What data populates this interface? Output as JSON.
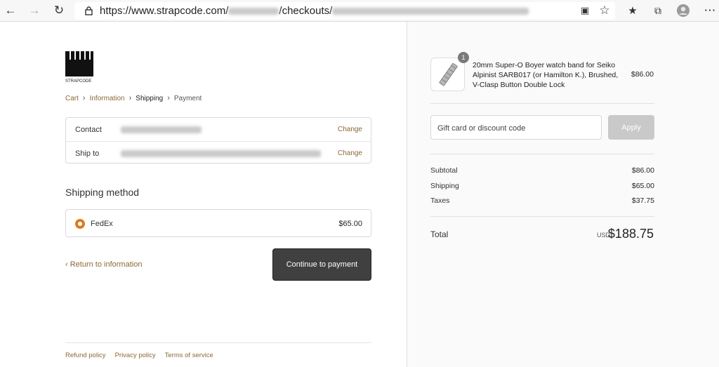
{
  "browser": {
    "url_prefix": "https://www.strapcode.com/",
    "url_mid": "/checkouts/"
  },
  "breadcrumbs": {
    "cart": "Cart",
    "information": "Information",
    "shipping": "Shipping",
    "payment": "Payment"
  },
  "review": {
    "contact_label": "Contact",
    "ship_to_label": "Ship to",
    "change": "Change"
  },
  "shipping": {
    "title": "Shipping method",
    "option_name": "FedEx",
    "option_price": "$65.00"
  },
  "actions": {
    "return": "Return to information",
    "continue": "Continue to payment"
  },
  "footer": {
    "refund": "Refund policy",
    "privacy": "Privacy policy",
    "terms": "Terms of service"
  },
  "summary": {
    "product": {
      "quantity": "1",
      "name": "20mm Super-O Boyer watch band for Seiko Alpinist SARB017 (or Hamilton K.), Brushed, V-Clasp Button Double Lock",
      "price": "$86.00"
    },
    "gift_placeholder": "Gift card or discount code",
    "apply": "Apply",
    "subtotal_label": "Subtotal",
    "subtotal": "$86.00",
    "shipping_label": "Shipping",
    "shipping": "$65.00",
    "taxes_label": "Taxes",
    "taxes": "$37.75",
    "total_label": "Total",
    "currency": "USD",
    "total": "$188.75"
  },
  "logo_text": "STRAPCODE",
  "colors": {
    "accent": "#8a6a36",
    "radio": "#e07a1f",
    "button": "#404040"
  }
}
